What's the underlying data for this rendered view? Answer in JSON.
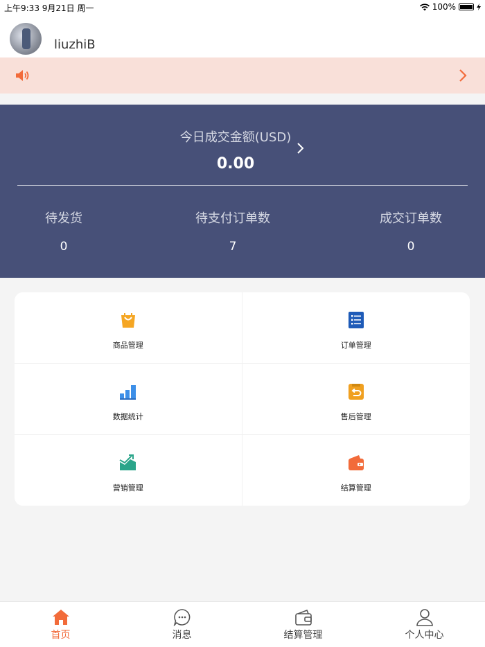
{
  "status_bar": {
    "time_date": "上午9:33   9月21日 周一",
    "battery": "100%"
  },
  "user": {
    "name": "liuzhiB"
  },
  "panel": {
    "amount_label": "今日成交金额(USD)",
    "amount_value": "0.00",
    "stats": [
      {
        "label": "待发货",
        "value": "0"
      },
      {
        "label": "待支付订单数",
        "value": "7"
      },
      {
        "label": "成交订单数",
        "value": "0"
      }
    ]
  },
  "menu": [
    {
      "label": "商品管理",
      "icon": "shopping-bag-icon",
      "color": "#f5a623"
    },
    {
      "label": "订单管理",
      "icon": "order-list-icon",
      "color": "#1e5bb8"
    },
    {
      "label": "数据统计",
      "icon": "bar-chart-icon",
      "color": "#3d8fe8"
    },
    {
      "label": "售后管理",
      "icon": "return-icon",
      "color": "#f0a020"
    },
    {
      "label": "营销管理",
      "icon": "trend-chart-icon",
      "color": "#2aa58a"
    },
    {
      "label": "结算管理",
      "icon": "wallet-icon",
      "color": "#f26b3a"
    }
  ],
  "tabs": [
    {
      "label": "首页",
      "icon": "home-icon",
      "active": true
    },
    {
      "label": "消息",
      "icon": "message-icon",
      "active": false
    },
    {
      "label": "结算管理",
      "icon": "wallet-icon",
      "active": false
    },
    {
      "label": "个人中心",
      "icon": "person-icon",
      "active": false
    }
  ],
  "colors": {
    "accent": "#f26b3a",
    "panel": "#475078",
    "notice_bg": "#f9e0d9"
  }
}
